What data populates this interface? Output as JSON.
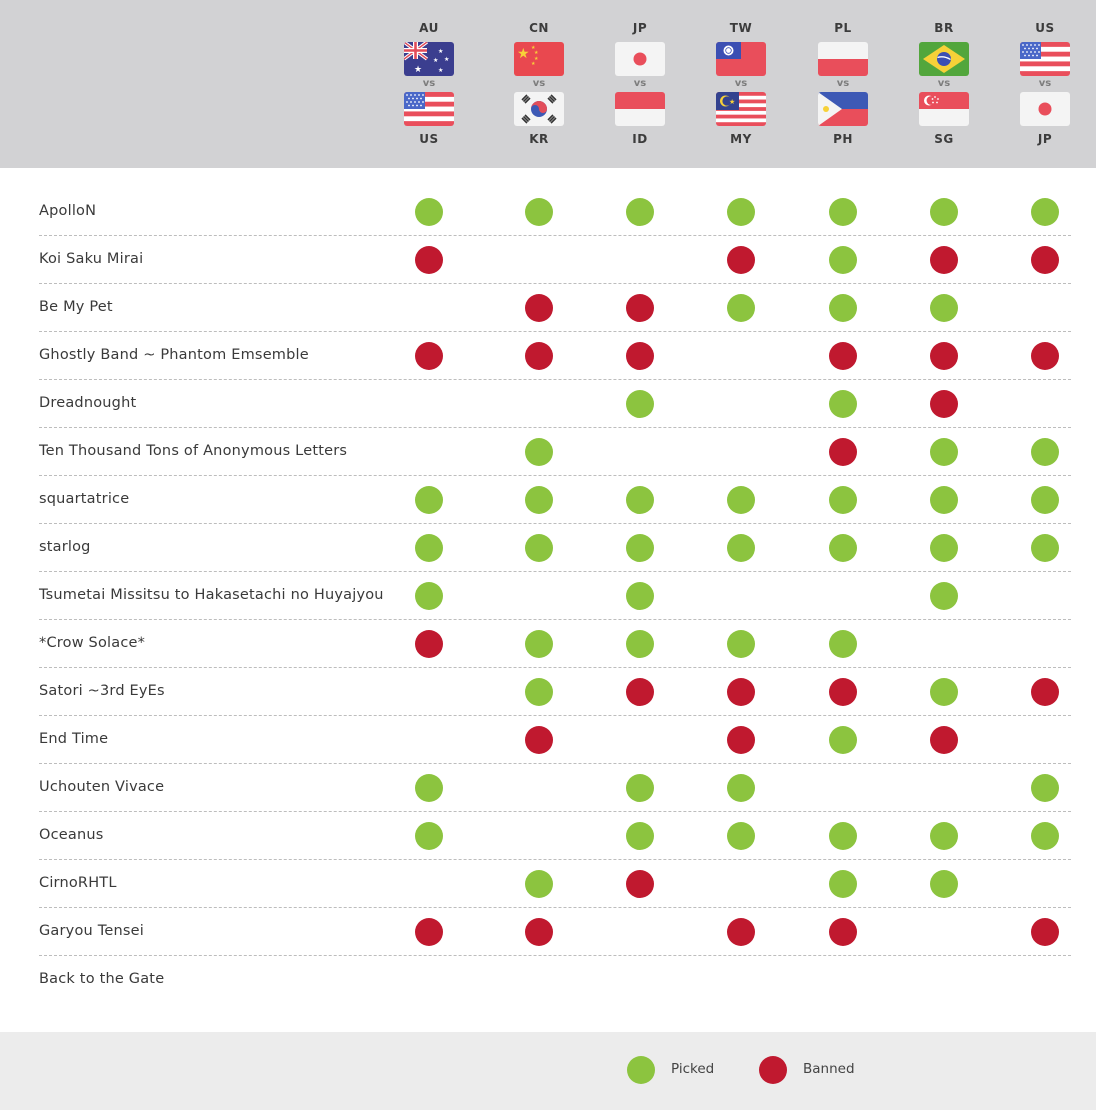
{
  "chart_data": {
    "type": "table",
    "colors": {
      "picked": "#8cc43f",
      "banned": "#c0192f",
      "header_bg": "#d2d2d4",
      "legend_bg": "#ececec"
    },
    "matches": [
      {
        "team1": "AU",
        "team2": "US",
        "flag1": "flag-au-icon",
        "flag2": "flag-us-icon"
      },
      {
        "team1": "CN",
        "team2": "KR",
        "flag1": "flag-cn-icon",
        "flag2": "flag-kr-icon"
      },
      {
        "team1": "JP",
        "team2": "ID",
        "flag1": "flag-jp-icon",
        "flag2": "flag-id-icon"
      },
      {
        "team1": "TW",
        "team2": "MY",
        "flag1": "flag-tw-icon",
        "flag2": "flag-my-icon"
      },
      {
        "team1": "PL",
        "team2": "PH",
        "flag1": "flag-pl-icon",
        "flag2": "flag-ph-icon"
      },
      {
        "team1": "BR",
        "team2": "SG",
        "flag1": "flag-br-icon",
        "flag2": "flag-sg-icon"
      },
      {
        "team1": "US",
        "team2": "JP",
        "flag1": "flag-us-icon",
        "flag2": "flag-jp-icon"
      }
    ],
    "vs_label": "vs",
    "songs": [
      {
        "name": "ApolloN",
        "status": [
          "picked",
          "picked",
          "picked",
          "picked",
          "picked",
          "picked",
          "picked"
        ]
      },
      {
        "name": "Koi Saku Mirai",
        "status": [
          "banned",
          null,
          null,
          "banned",
          "picked",
          "banned",
          "banned"
        ]
      },
      {
        "name": "Be My Pet",
        "status": [
          null,
          "banned",
          "banned",
          "picked",
          "picked",
          "picked",
          null
        ]
      },
      {
        "name": "Ghostly Band ~ Phantom Emsemble",
        "status": [
          "banned",
          "banned",
          "banned",
          null,
          "banned",
          "banned",
          "banned"
        ]
      },
      {
        "name": "Dreadnought",
        "status": [
          null,
          null,
          "picked",
          null,
          "picked",
          "banned",
          null
        ]
      },
      {
        "name": "Ten Thousand Tons of Anonymous Letters",
        "status": [
          null,
          "picked",
          null,
          null,
          "banned",
          "picked",
          "picked"
        ]
      },
      {
        "name": "squartatrice",
        "status": [
          "picked",
          "picked",
          "picked",
          "picked",
          "picked",
          "picked",
          "picked"
        ]
      },
      {
        "name": "starlog",
        "status": [
          "picked",
          "picked",
          "picked",
          "picked",
          "picked",
          "picked",
          "picked"
        ]
      },
      {
        "name": "Tsumetai Missitsu to Hakasetachi no Huyajyou",
        "status": [
          "picked",
          null,
          "picked",
          null,
          null,
          "picked",
          null
        ]
      },
      {
        "name": "*Crow Solace*",
        "status": [
          "banned",
          "picked",
          "picked",
          "picked",
          "picked",
          null,
          null
        ]
      },
      {
        "name": "Satori ~3rd EyEs",
        "status": [
          null,
          "picked",
          "banned",
          "banned",
          "banned",
          "picked",
          "banned"
        ]
      },
      {
        "name": "End Time",
        "status": [
          null,
          "banned",
          null,
          "banned",
          "picked",
          "banned",
          null
        ]
      },
      {
        "name": "Uchouten Vivace",
        "status": [
          "picked",
          null,
          "picked",
          "picked",
          null,
          null,
          "picked"
        ]
      },
      {
        "name": "Oceanus",
        "status": [
          "picked",
          null,
          "picked",
          "picked",
          "picked",
          "picked",
          "picked"
        ]
      },
      {
        "name": "CirnoRHTL",
        "status": [
          null,
          "picked",
          "banned",
          null,
          "picked",
          "picked",
          null
        ]
      },
      {
        "name": "Garyou Tensei",
        "status": [
          "banned",
          "banned",
          null,
          "banned",
          "banned",
          null,
          "banned"
        ]
      },
      {
        "name": "Back to the Gate",
        "status": [
          null,
          null,
          null,
          null,
          null,
          null,
          null
        ]
      }
    ],
    "legend": [
      {
        "key": "picked",
        "label": "Picked"
      },
      {
        "key": "banned",
        "label": "Banned"
      }
    ]
  }
}
